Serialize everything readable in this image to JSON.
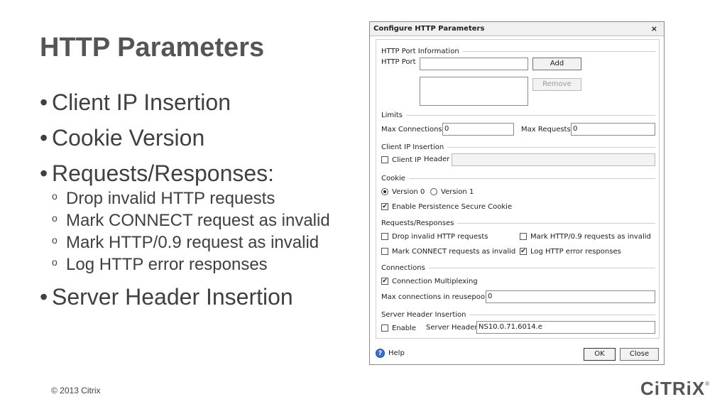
{
  "slide": {
    "title": "HTTP Parameters",
    "bullets": [
      {
        "text": "Client IP Insertion"
      },
      {
        "text": "Cookie Version"
      },
      {
        "text": "Requests/Responses:",
        "sub": [
          "Drop invalid HTTP requests",
          "Mark CONNECT request as invalid",
          "Mark HTTP/0.9 request as invalid",
          "Log HTTP error responses"
        ]
      },
      {
        "text": "Server Header Insertion"
      }
    ],
    "bullet_glyph": "•",
    "sub_bullet_glyph": "o",
    "footer": "© 2013 Citrix",
    "logo": "CiTRiX",
    "logo_mark": "®"
  },
  "dialog": {
    "title": "Configure HTTP Parameters",
    "close_glyph": "×",
    "port_section": {
      "label": "HTTP Port Information",
      "port_label": "HTTP Port",
      "port_value": "",
      "add_label": "Add",
      "remove_label": "Remove"
    },
    "limits": {
      "label": "Limits",
      "max_connections_label": "Max Connections",
      "max_connections_value": "0",
      "max_requests_label": "Max Requests",
      "max_requests_value": "0"
    },
    "client_ip": {
      "label": "Client IP Insertion",
      "checkbox_label": "Client IP",
      "header_label": "Header",
      "header_value": "",
      "checked": false
    },
    "cookie": {
      "label": "Cookie",
      "version0_label": "Version 0",
      "version1_label": "Version 1",
      "selected": "Version 0",
      "persistence_label": "Enable Persistence Secure Cookie",
      "persistence_checked": true
    },
    "requests": {
      "label": "Requests/Responses",
      "drop_invalid": {
        "label": "Drop invalid HTTP requests",
        "checked": false
      },
      "mark_http09": {
        "label": "Mark HTTP/0.9 requests as invalid",
        "checked": false
      },
      "mark_connect": {
        "label": "Mark CONNECT requests as invalid",
        "checked": false
      },
      "log_errors": {
        "label": "Log HTTP error responses",
        "checked": true
      }
    },
    "connections": {
      "label": "Connections",
      "multiplexing_label": "Connection Multiplexing",
      "multiplexing_checked": true,
      "max_reuse_label": "Max connections in reusepool",
      "max_reuse_value": "0"
    },
    "server_header": {
      "label": "Server Header Insertion",
      "enable_label": "Enable",
      "enable_checked": false,
      "header_label": "Server Header",
      "header_value": "NS10.0.71.6014.e"
    },
    "footer": {
      "help_label": "Help",
      "help_glyph": "?",
      "ok_label": "OK",
      "close_label": "Close"
    },
    "check_glyph": "✔"
  }
}
